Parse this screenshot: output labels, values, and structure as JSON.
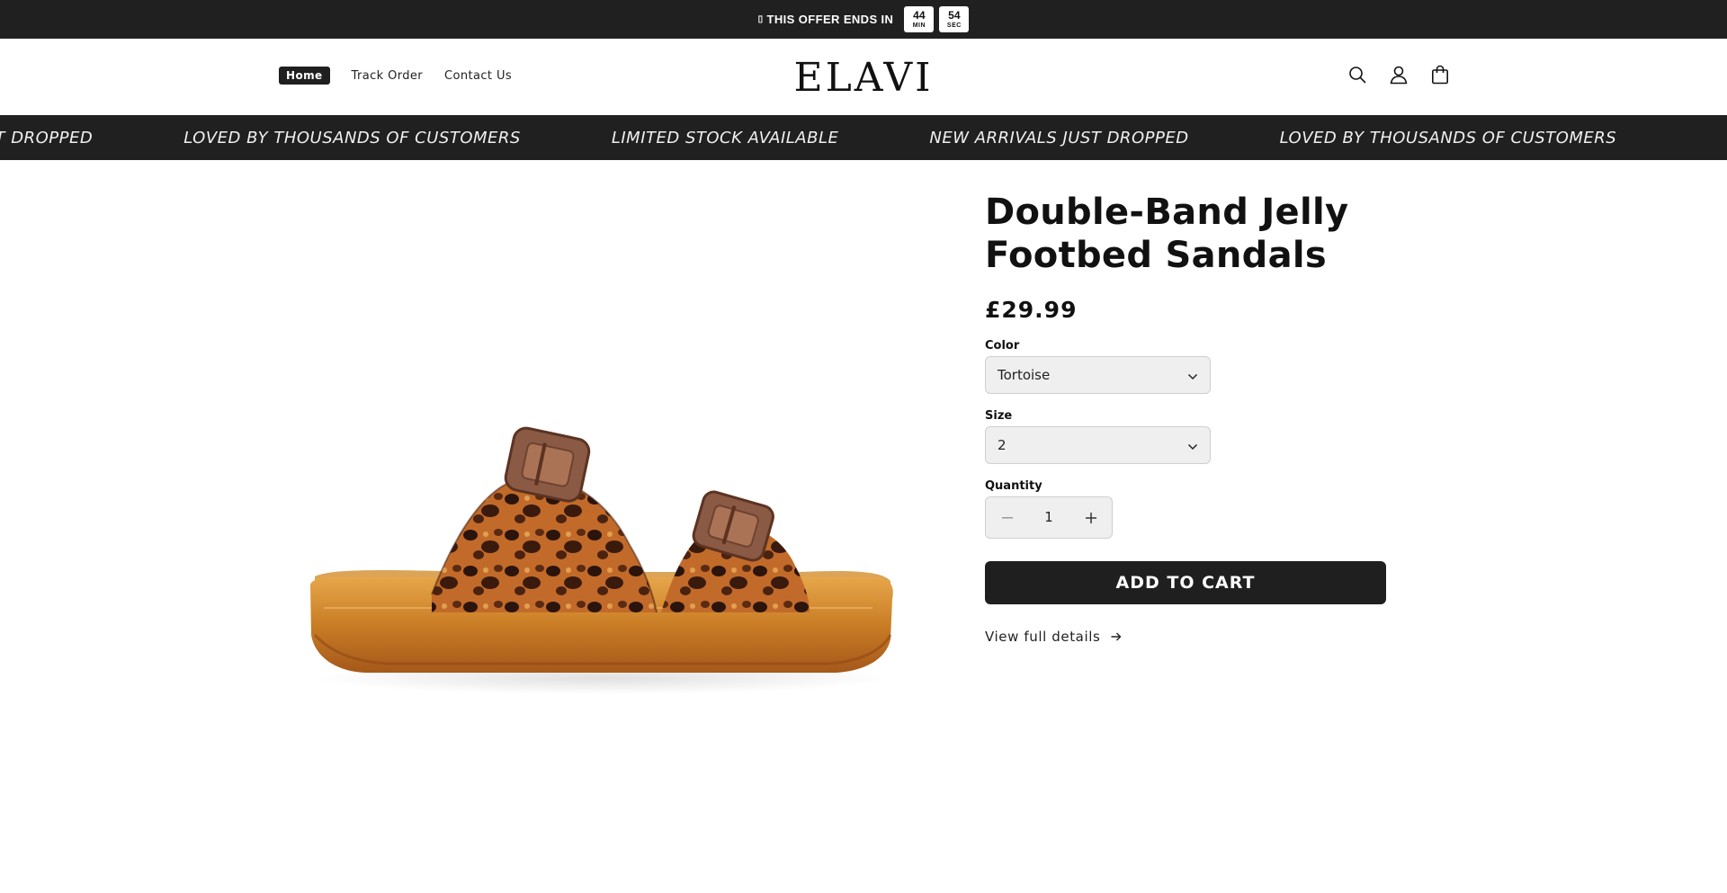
{
  "announcement": {
    "icon": "fire-icon",
    "text": "THIS OFFER ENDS IN",
    "countdown": [
      {
        "value": "44",
        "unit": "MIN"
      },
      {
        "value": "54",
        "unit": "SEC"
      }
    ]
  },
  "header": {
    "nav": [
      {
        "label": "Home",
        "active": true
      },
      {
        "label": "Track Order",
        "active": false
      },
      {
        "label": "Contact Us",
        "active": false
      }
    ],
    "logo": "ELAVI",
    "icons": [
      "search-icon",
      "account-icon",
      "cart-icon"
    ]
  },
  "marquee": {
    "items": [
      "NEW ARRIVALS JUST DROPPED",
      "LOVED BY THOUSANDS OF CUSTOMERS",
      "LIMITED STOCK AVAILABLE",
      "NEW ARRIVALS JUST DROPPED",
      "LOVED BY THOUSANDS OF CUSTOMERS"
    ]
  },
  "product": {
    "title_line1": "Double-Band Jelly",
    "title_line2": "Footbed Sandals",
    "price": "£29.99",
    "color_label": "Color",
    "color_value": "Tortoise",
    "size_label": "Size",
    "size_value": "2",
    "quantity_label": "Quantity",
    "quantity_value": "1",
    "add_to_cart": "ADD TO CART",
    "view_details": "View full details"
  },
  "colors": {
    "dark": "#202020",
    "button": "#1f1f1f",
    "field_bg": "#efefef"
  }
}
